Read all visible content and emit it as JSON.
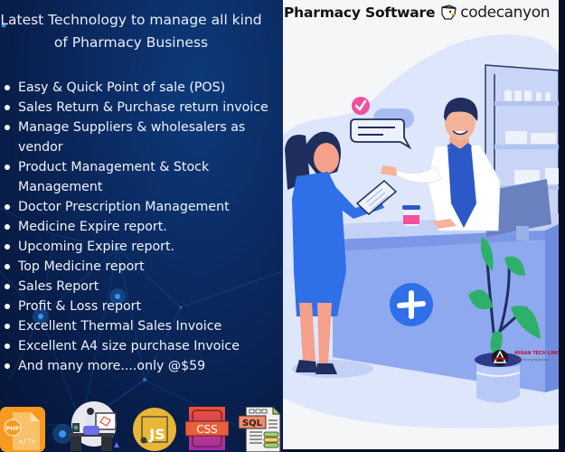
{
  "left_panel": {
    "headline": "Latest Technology to manage all kind of Pharmacy Business",
    "features": [
      "Easy & Quick Point of sale (POS)",
      "Sales Return & Purchase return invoice",
      "Manage Suppliers & wholesalers as vendor",
      "Product Management & Stock Management",
      "Doctor Prescription Management",
      "Medicine Expire  report.",
      "Upcoming Expire report.",
      "Top Medicine report",
      "Sales Report",
      "Profit & Loss report",
      "Excellent Thermal Sales Invoice",
      "Excellent A4 size purchase Invoice",
      "And many more....only @$59"
    ],
    "tech_icons": [
      {
        "name": "php-file-icon",
        "label": "PHP"
      },
      {
        "name": "laravel-developer-icon",
        "label": ""
      },
      {
        "name": "javascript-icon",
        "label": "JS"
      },
      {
        "name": "css-icon",
        "label": "CSS"
      },
      {
        "name": "sql-database-icon",
        "label": "SQL"
      }
    ]
  },
  "right_panel": {
    "title": "Pharmacy Software",
    "marketplace": "codecanyon",
    "brand": {
      "name": "AYAAN TECH LIMITED",
      "tagline": "Make Everything Easy",
      "logo_letter": "A"
    }
  },
  "colors": {
    "left_bg": "#0b2b63",
    "right_bg": "#f5f6f8",
    "accent_blue": "#2f6fe8",
    "counter_blue": "#8eaaf0",
    "check_pink": "#f0529c",
    "plant_green": "#2fb06a",
    "js_yellow": "#e8b737",
    "php_orange": "#f79a1f"
  }
}
